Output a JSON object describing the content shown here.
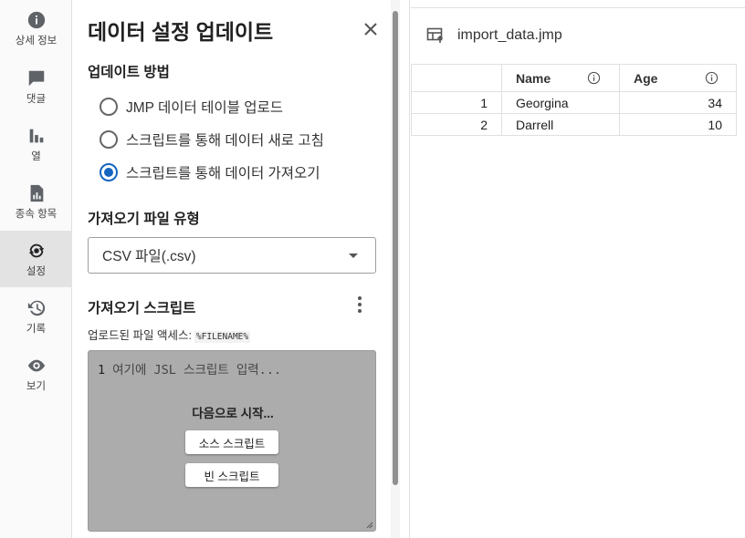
{
  "nav": {
    "items": [
      {
        "label": "상세 정보",
        "icon": "info-icon"
      },
      {
        "label": "댓글",
        "icon": "comment-icon"
      },
      {
        "label": "열",
        "icon": "columns-chart-icon"
      },
      {
        "label": "종속 항목",
        "icon": "dependencies-icon"
      },
      {
        "label": "설정",
        "icon": "settings-sync-icon",
        "active": true
      },
      {
        "label": "기록",
        "icon": "history-icon"
      },
      {
        "label": "보기",
        "icon": "eye-icon"
      }
    ]
  },
  "panel": {
    "title": "데이터 설정 업데이트",
    "update_method": {
      "heading": "업데이트 방법",
      "options": [
        {
          "label": "JMP 데이터 테이블 업로드",
          "checked": false
        },
        {
          "label": "스크립트를 통해 데이터 새로 고침",
          "checked": false
        },
        {
          "label": "스크립트를 통해 데이터 가져오기",
          "checked": true
        }
      ]
    },
    "file_type": {
      "heading": "가져오기 파일 유형",
      "selected": "CSV 파일(.csv)"
    },
    "import_script": {
      "heading": "가져오기 스크립트",
      "access_label": "업로드된 파일 액세스:",
      "access_token": "%FILENAME%",
      "line_number": "1",
      "placeholder": "여기에 JSL 스크립트 입력...",
      "start_label": "다음으로 시작...",
      "source_button": "소스 스크립트",
      "blank_button": "빈 스크립트"
    }
  },
  "table": {
    "title": "import_data.jmp",
    "columns": [
      "Name",
      "Age"
    ],
    "rows": [
      {
        "row": "1",
        "name": "Georgina",
        "age": "34"
      },
      {
        "row": "2",
        "name": "Darrell",
        "age": "10"
      }
    ]
  },
  "colors": {
    "accent": "#1565c0",
    "active_nav_bg": "#e3e3e3",
    "editor_bg": "#acacac"
  }
}
